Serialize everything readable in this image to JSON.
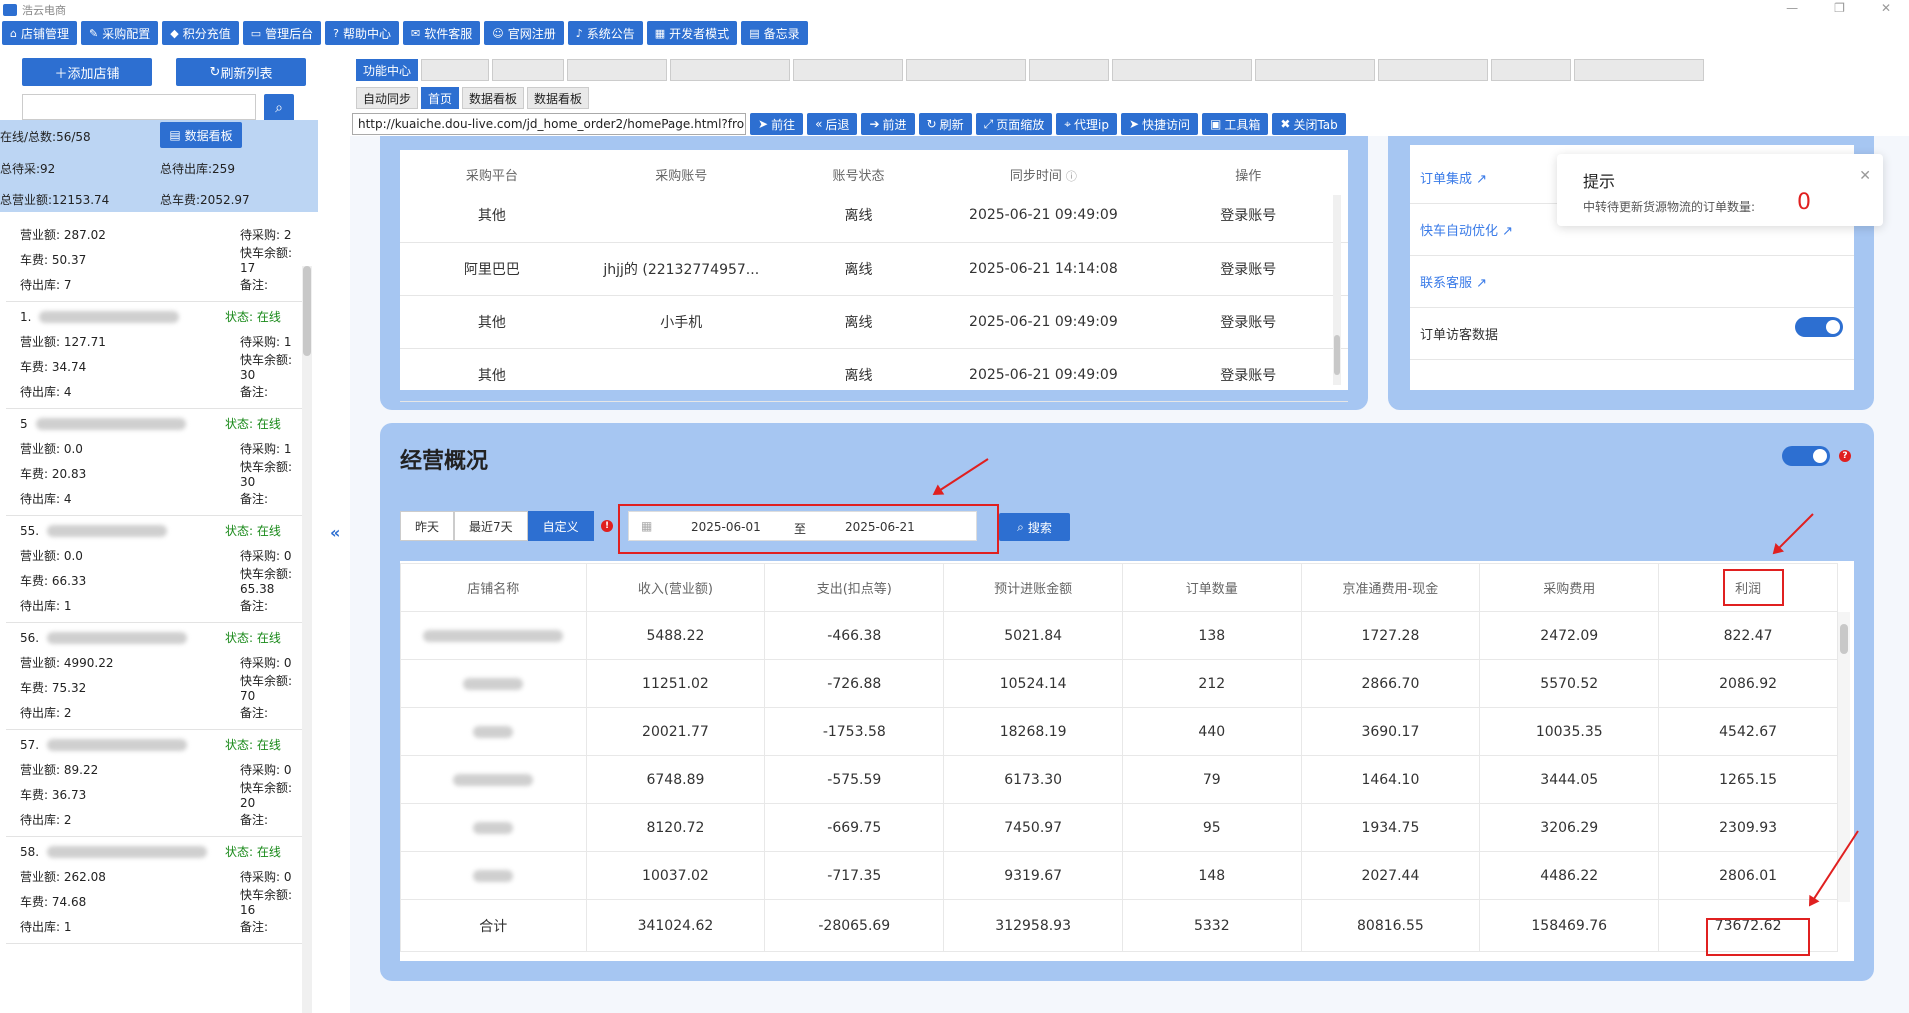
{
  "window": {
    "title": "浩云电商"
  },
  "mainbar": [
    {
      "label": "店铺管理",
      "icon": "home-icon",
      "glyph": "⌂"
    },
    {
      "label": "采购配置",
      "icon": "wrench-icon",
      "glyph": "✎"
    },
    {
      "label": "积分充值",
      "icon": "diamond-icon",
      "glyph": "◆"
    },
    {
      "label": "管理后台",
      "icon": "monitor-icon",
      "glyph": "▭"
    },
    {
      "label": "帮助中心",
      "icon": "help-icon",
      "glyph": "?"
    },
    {
      "label": "软件客服",
      "icon": "chat-icon",
      "glyph": "✉"
    },
    {
      "label": "官网注册",
      "icon": "user-icon",
      "glyph": "☺"
    },
    {
      "label": "系统公告",
      "icon": "bell-icon",
      "glyph": "♪"
    },
    {
      "label": "开发者模式",
      "icon": "windows-icon",
      "glyph": "▦"
    },
    {
      "label": "备忘录",
      "icon": "note-icon",
      "glyph": "▤"
    }
  ],
  "sidebar": {
    "add_label": "添加店铺",
    "refresh_label": "刷新列表",
    "search_value": "",
    "dashboard_label": "数据看板",
    "stats": {
      "online": "在线/总数:56/58",
      "pending_purchase": "总待采:92",
      "pending_out": "总待出库:259",
      "revenue": "总营业额:12153.74",
      "freight": "总车费:2052.97"
    },
    "shops": [
      {
        "title": "",
        "status": "",
        "revenue": "营业额: 287.02",
        "pending": "待采购: 2",
        "fee": "车费: 50.37",
        "balance": "快车余额: 17",
        "out": "待出库: 7",
        "note": "备注:"
      },
      {
        "title": "1.",
        "status": "状态: 在线",
        "revenue": "营业额: 127.71",
        "pending": "待采购: 1",
        "fee": "车费: 34.74",
        "balance": "快车余额: 30",
        "out": "待出库: 4",
        "note": "备注:"
      },
      {
        "title": "5",
        "status": "状态: 在线",
        "revenue": "营业额: 0.0",
        "pending": "待采购: 1",
        "fee": "车费: 20.83",
        "balance": "快车余额: 30",
        "out": "待出库: 4",
        "note": "备注:"
      },
      {
        "title": "55.",
        "status": "状态: 在线",
        "revenue": "营业额: 0.0",
        "pending": "待采购: 0",
        "fee": "车费: 66.33",
        "balance": "快车余额: 65.38",
        "out": "待出库: 1",
        "note": "备注:"
      },
      {
        "title": "56.",
        "status": "状态: 在线",
        "revenue": "营业额: 4990.22",
        "pending": "待采购: 0",
        "fee": "车费: 75.32",
        "balance": "快车余额: 70",
        "out": "待出库: 2",
        "note": "备注:"
      },
      {
        "title": "57.",
        "status": "状态: 在线",
        "revenue": "营业额: 89.22",
        "pending": "待采购: 0",
        "fee": "车费: 36.73",
        "balance": "快车余额: 20",
        "out": "待出库: 2",
        "note": "备注:"
      },
      {
        "title": "58.",
        "status": "状态: 在线",
        "revenue": "营业额: 262.08",
        "pending": "待采购: 0",
        "fee": "车费: 74.68",
        "balance": "快车余额: 16",
        "out": "待出库: 1",
        "note": "备注:"
      }
    ]
  },
  "tabs_top": [
    "功能中心",
    "",
    "",
    "",
    "",
    "",
    "",
    "",
    "",
    "",
    "",
    "",
    ""
  ],
  "tabs_sub": [
    "自动同步",
    "首页",
    "数据看板",
    "数据看板"
  ],
  "nav": {
    "url": "http://kuaiche.dou-live.com/jd_home_order2/homePage.html?from",
    "buttons": [
      "前往",
      "后退",
      "前进",
      "刷新",
      "页面缩放",
      "代理ip",
      "快捷访问",
      "工具箱",
      "关闭Tab"
    ]
  },
  "accounts": {
    "headers": [
      "采购平台",
      "采购账号",
      "账号状态",
      "同步时间",
      "操作"
    ],
    "rows": [
      {
        "platform": "其他",
        "account": "",
        "status": "离线",
        "time": "2025-06-21 09:49:09",
        "action": "登录账号"
      },
      {
        "platform": "阿里巴巴",
        "account": "jhjj的 (22132774957...",
        "status": "离线",
        "time": "2025-06-21 14:14:08",
        "action": "登录账号"
      },
      {
        "platform": "其他",
        "account": "小手机",
        "status": "离线",
        "time": "2025-06-21 09:49:09",
        "action": "登录账号"
      },
      {
        "platform": "其他",
        "account": "",
        "status": "离线",
        "time": "2025-06-21 09:49:09",
        "action": "登录账号"
      }
    ]
  },
  "right_links": [
    "订单集成 ↗",
    "快车自动优化 ↗",
    "联系客服 ↗",
    "订单访客数据"
  ],
  "toast": {
    "title": "提示",
    "message": "中转待更新货源物流的订单数量:",
    "count": "0"
  },
  "overview": {
    "title": "经营概况",
    "quick": [
      "昨天",
      "最近7天",
      "自定义"
    ],
    "start_date": "2025-06-01",
    "sep": "至",
    "end_date": "2025-06-21",
    "search_label": "搜索",
    "headers": [
      "店铺名称",
      "收入(营业额)",
      "支出(扣点等)",
      "预计进账金额",
      "订单数量",
      "京准通费用-现金",
      "采购费用",
      "利润"
    ],
    "rows": [
      {
        "income": "5488.22",
        "expense": "-466.38",
        "expected": "5021.84",
        "orders": "138",
        "jzt": "1727.28",
        "purchase": "2472.09",
        "profit": "822.47"
      },
      {
        "income": "11251.02",
        "expense": "-726.88",
        "expected": "10524.14",
        "orders": "212",
        "jzt": "2866.70",
        "purchase": "5570.52",
        "profit": "2086.92"
      },
      {
        "income": "20021.77",
        "expense": "-1753.58",
        "expected": "18268.19",
        "orders": "440",
        "jzt": "3690.17",
        "purchase": "10035.35",
        "profit": "4542.67"
      },
      {
        "income": "6748.89",
        "expense": "-575.59",
        "expected": "6173.30",
        "orders": "79",
        "jzt": "1464.10",
        "purchase": "3444.05",
        "profit": "1265.15"
      },
      {
        "income": "8120.72",
        "expense": "-669.75",
        "expected": "7450.97",
        "orders": "95",
        "jzt": "1934.75",
        "purchase": "3206.29",
        "profit": "2309.93"
      },
      {
        "income": "10037.02",
        "expense": "-717.35",
        "expected": "9319.67",
        "orders": "148",
        "jzt": "2027.44",
        "purchase": "4486.22",
        "profit": "2806.01"
      }
    ],
    "total": {
      "label": "合计",
      "income": "341024.62",
      "expense": "-28065.69",
      "expected": "312958.93",
      "orders": "5332",
      "jzt": "80816.55",
      "purchase": "158469.76",
      "profit": "73672.62"
    }
  }
}
